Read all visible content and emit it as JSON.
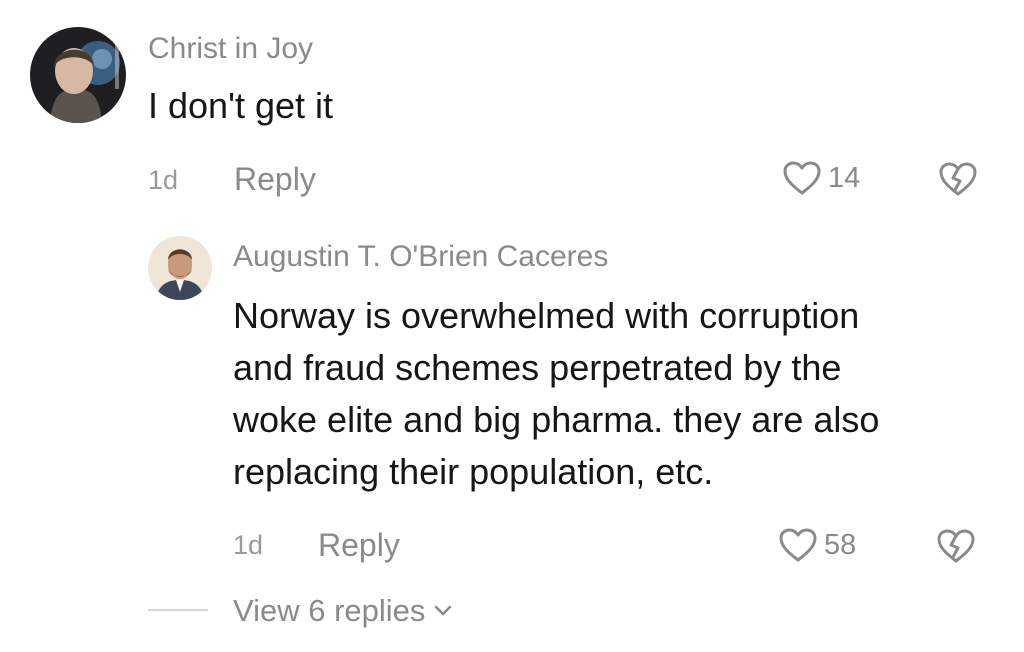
{
  "comment": {
    "username": "Christ in Joy",
    "text": "I don't get it",
    "age": "1d",
    "reply_label": "Reply",
    "like_count": "14"
  },
  "reply": {
    "username": "Augustin T. O'Brien Caceres",
    "text_lines": [
      "Norway is overwhelmed with corruption",
      "and fraud schemes perpetrated by the",
      "woke elite and big pharma. they are also",
      "replacing their population, etc."
    ],
    "age": "1d",
    "reply_label": "Reply",
    "like_count": "58"
  },
  "view_replies": {
    "label": "View 6 replies"
  },
  "icons": {
    "like": "heart-outline-icon",
    "dislike": "broken-heart-icon",
    "expand": "chevron-down-icon"
  },
  "colors": {
    "text_primary": "#161616",
    "text_secondary": "#8a8a8a"
  }
}
